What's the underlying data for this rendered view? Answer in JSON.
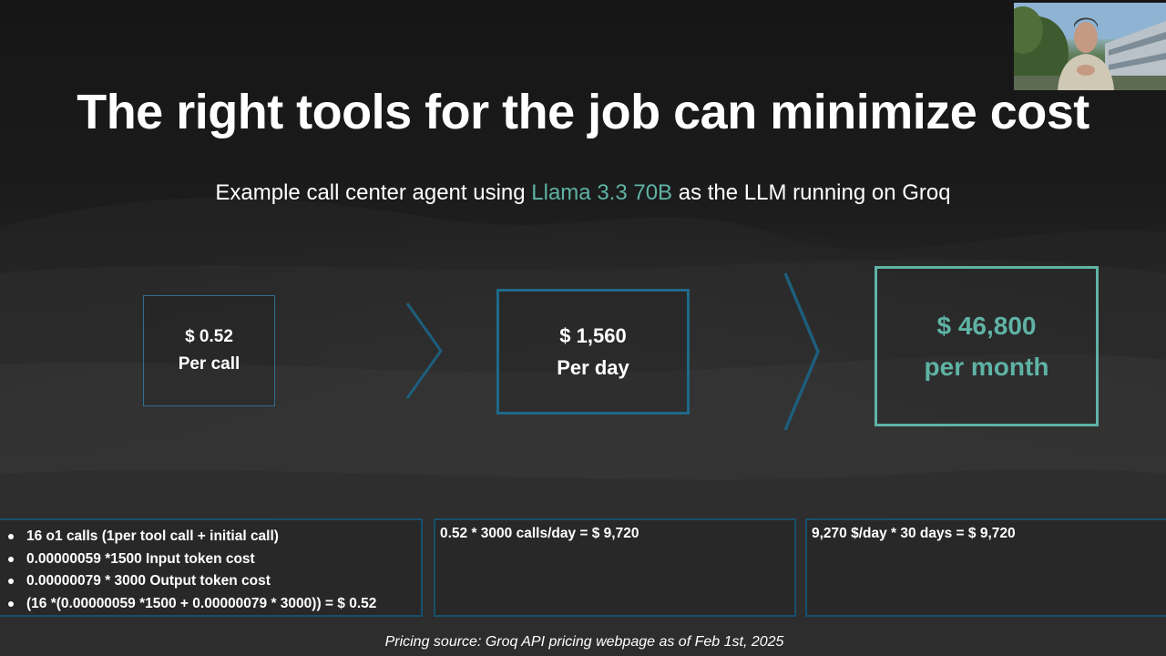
{
  "slide": {
    "title": "The right tools for the job can minimize cost",
    "subtitle": {
      "prefix": "Example call center agent using ",
      "highlight": "Llama 3.3 70B",
      "suffix": " as the LLM running on Groq"
    },
    "boxes": {
      "per_call": {
        "amount": "$ 0.52",
        "label": "Per call"
      },
      "per_day": {
        "amount": "$ 1,560",
        "label": "Per day"
      },
      "per_month": {
        "amount": "$ 46,800",
        "label": "per month"
      }
    },
    "calculations": {
      "per_call_bullets": [
        "16 o1 calls (1per tool call + initial call)",
        "0.00000059 *1500 Input token cost",
        "0.00000079 * 3000 Output token cost",
        "(16 *(0.00000059 *1500 + 0.00000079 * 3000)) = $ 0.52"
      ],
      "per_day": "0.52 * 3000 calls/day =  $ 9,720",
      "per_month": "9,270 $/day * 30 days =  $ 9,720"
    },
    "source": "Pricing source: Groq API pricing webpage as of Feb 1st, 2025"
  },
  "colors": {
    "background": "#1b1b1b",
    "text": "#ffffff",
    "accent_teal": "#5fb3a5",
    "box_blue": "#1e6a8a",
    "calc_border": "#17506e"
  },
  "icons": {
    "arrow_1": "chevron-right-icon",
    "arrow_2": "chevron-right-icon"
  }
}
